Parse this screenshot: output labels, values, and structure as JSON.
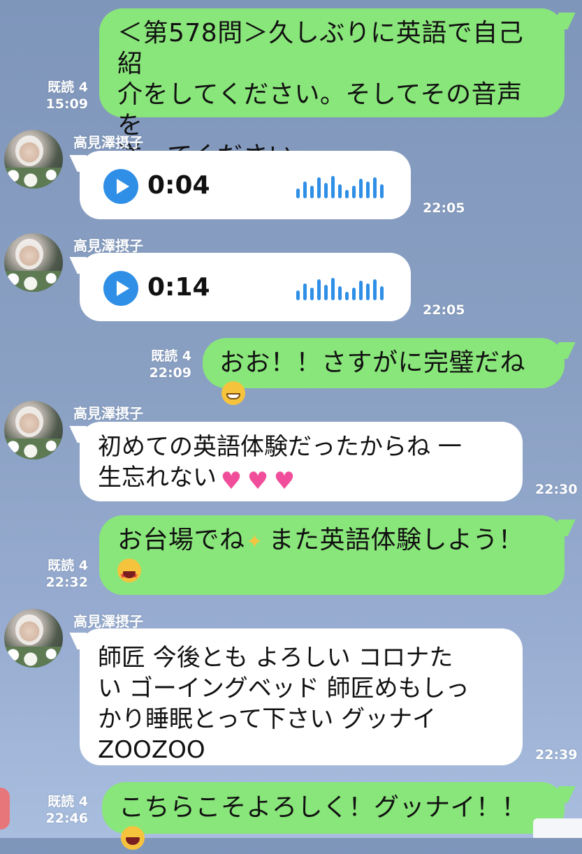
{
  "chat": {
    "messages": [
      {
        "type": "outgoing",
        "lines": [
          "＜第578問＞久しぶりに英語で自己紹",
          "介をしてください。そしてその音声を",
          "送ってください。"
        ],
        "read": "既読 4",
        "time": "15:09"
      },
      {
        "type": "incoming-voice",
        "sender": "高見澤摂子",
        "duration": "0:04",
        "time": "22:05"
      },
      {
        "type": "incoming-voice",
        "sender": "高見澤摂子",
        "duration": "0:14",
        "time": "22:05"
      },
      {
        "type": "outgoing",
        "text": "おお！！さすがに完璧だね",
        "emoji": "grinning-face",
        "read": "既読 4",
        "time": "22:09"
      },
      {
        "type": "incoming",
        "sender": "高見澤摂子",
        "lines": [
          "初めての英語体験だったからね 一",
          "生忘れない"
        ],
        "emoji": [
          "sparkling-heart",
          "sparkling-heart",
          "sparkling-heart"
        ],
        "time": "22:30"
      },
      {
        "type": "outgoing",
        "line1_a": "お台場でね",
        "line1_b": "また英語体験しよう！",
        "emoji": [
          "sparkles",
          "star-struck"
        ],
        "read": "既読 4",
        "time": "22:32"
      },
      {
        "type": "incoming",
        "sender": "高見澤摂子",
        "lines": [
          "師匠 今後とも よろしい コロナた",
          "い ゴーイングベッド 師匠めもしっ",
          "かり睡眠とって下さい グッナイ",
          "ZOOZOO"
        ],
        "time": "22:39"
      },
      {
        "type": "outgoing",
        "text": "こちらこそよろしく！グッナイ！！",
        "emoji": "laughing-face",
        "read": "既読 4",
        "time": "22:46"
      }
    ]
  },
  "colors": {
    "background": "#8aa0c3",
    "outgoing_bubble": "#89e67a",
    "incoming_bubble": "#ffffff",
    "voice_accent": "#2f8fe6"
  },
  "icons": {
    "play": "play-icon",
    "waveform": "waveform-icon",
    "avatar": "avatar"
  }
}
